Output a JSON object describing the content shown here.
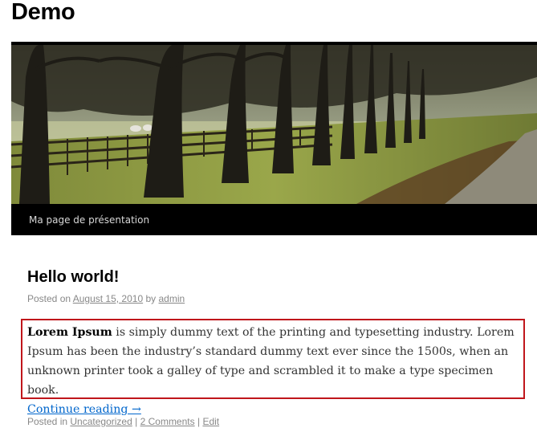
{
  "site": {
    "title": "Demo"
  },
  "menu": {
    "items": [
      {
        "label": "Ma page de présentation"
      }
    ]
  },
  "post": {
    "title": "Hello world!",
    "meta": {
      "posted_on": "Posted on",
      "date": "August 15, 2010",
      "by": "by",
      "author": "admin"
    },
    "excerpt": {
      "lead": "Lorem Ipsum",
      "body": " is simply dummy text of the printing and typesetting industry. Lorem Ipsum has been the industry’s standard dummy text ever since the 1500s, when an unknown printer took a galley of type and scrambled it to make a type specimen book.",
      "continue_label": "Continue reading →"
    },
    "footer": {
      "posted_in": "Posted in",
      "category": "Uncategorized",
      "sep1": "|",
      "comments": "2 Comments",
      "sep2": "|",
      "edit": "Edit"
    }
  },
  "colors": {
    "excerpt_border": "#c0161b",
    "link": "#0066cc",
    "menu_bg": "#000000"
  }
}
